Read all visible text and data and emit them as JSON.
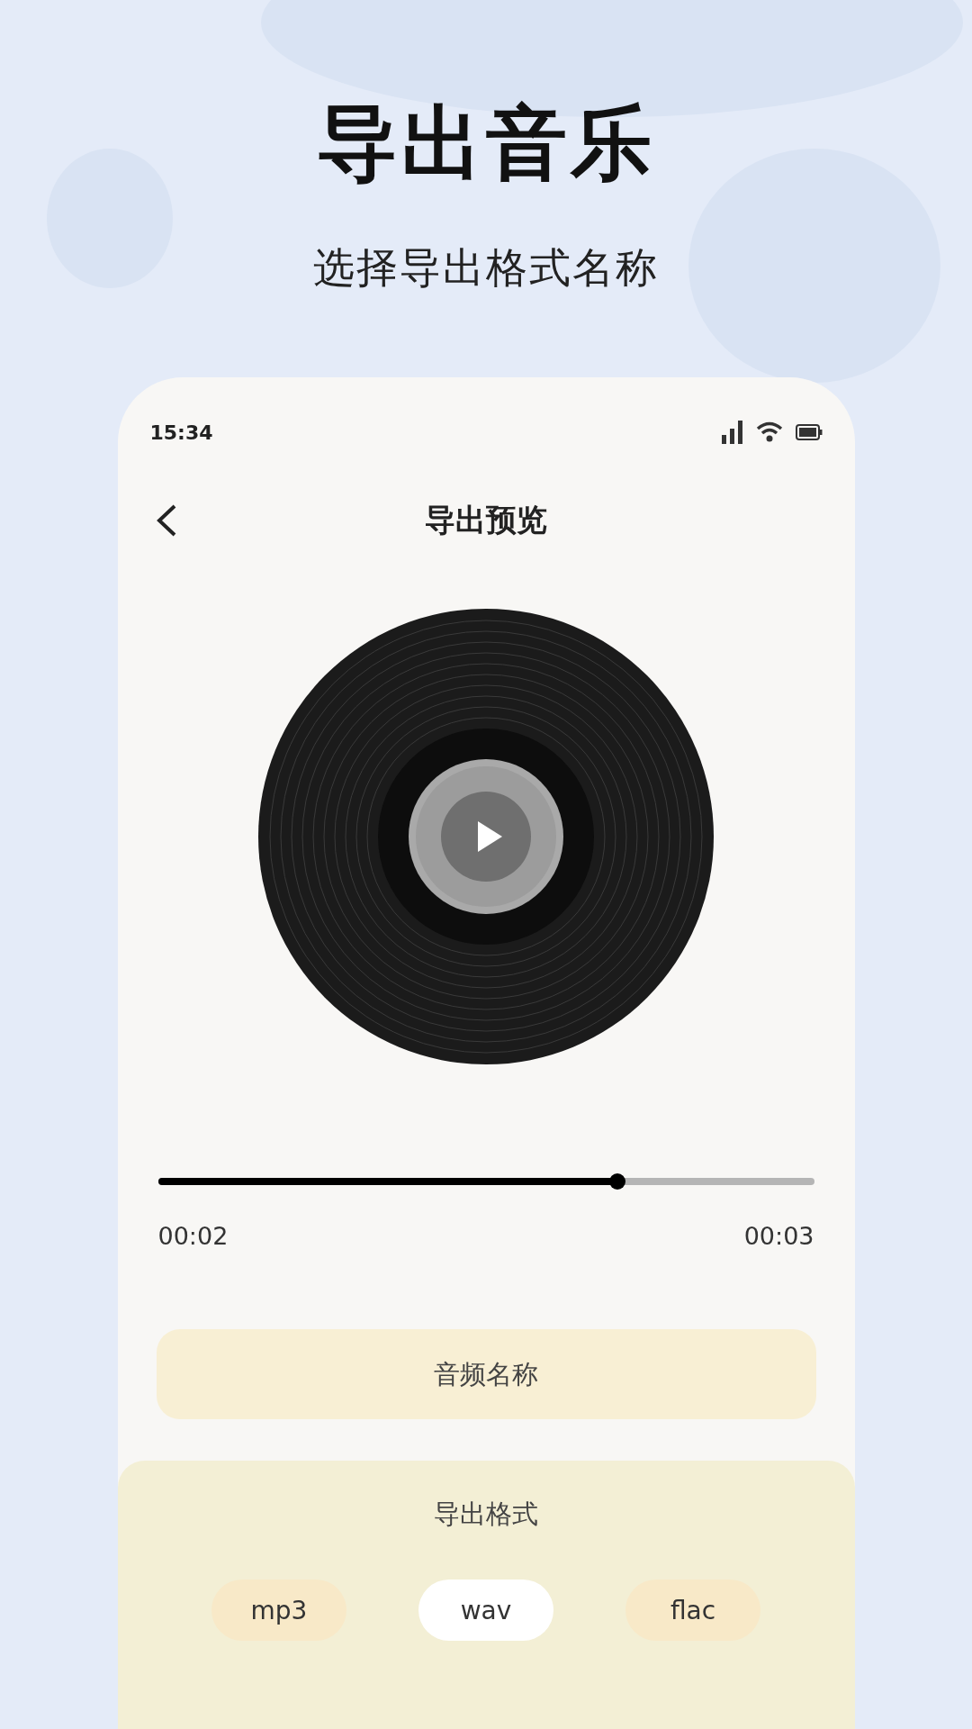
{
  "headline": "导出音乐",
  "subtitle": "选择导出格式名称",
  "status_bar": {
    "time": "15:34"
  },
  "nav": {
    "title": "导出预览"
  },
  "progress": {
    "level": 0.7,
    "elapsed": "00:02",
    "total": "00:03"
  },
  "name_field": {
    "placeholder": "音频名称"
  },
  "export_format": {
    "label": "导出格式",
    "options": [
      {
        "label": "mp3",
        "selected": false
      },
      {
        "label": "wav",
        "selected": true
      },
      {
        "label": "flac",
        "selected": false
      }
    ]
  }
}
